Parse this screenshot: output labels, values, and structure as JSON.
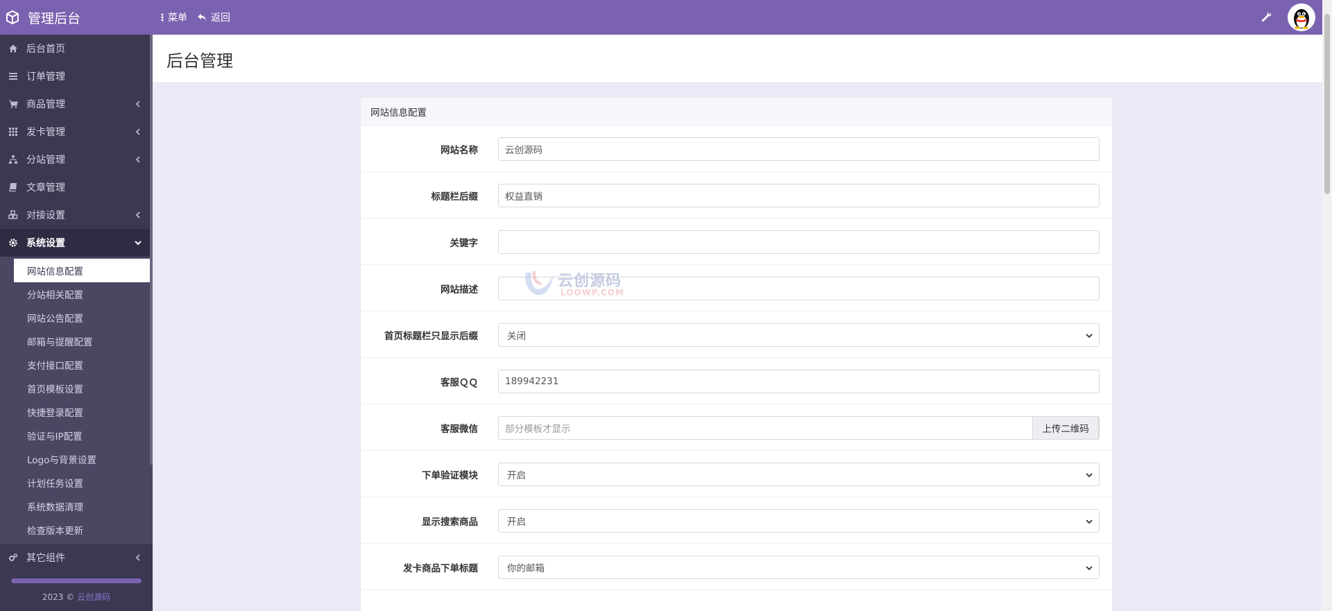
{
  "topbar": {
    "brand_title": "管理后台",
    "menu_label": "菜单",
    "back_label": "返回",
    "bg_color": "#7b62b0"
  },
  "sidebar": {
    "items_top": [
      {
        "label": "后台首页",
        "icon": "home-icon",
        "has_chevron": false
      },
      {
        "label": "订单管理",
        "icon": "list-icon",
        "has_chevron": false
      },
      {
        "label": "商品管理",
        "icon": "cart-icon",
        "has_chevron": true
      },
      {
        "label": "发卡管理",
        "icon": "grid-icon",
        "has_chevron": true
      },
      {
        "label": "分站管理",
        "icon": "sitemap-icon",
        "has_chevron": true
      },
      {
        "label": "文章管理",
        "icon": "book-icon",
        "has_chevron": false
      },
      {
        "label": "对接设置",
        "icon": "cubes-icon",
        "has_chevron": true
      }
    ],
    "active_group": {
      "label": "系统设置",
      "icon": "gear-icon"
    },
    "sub_items": [
      "网站信息配置",
      "分站相关配置",
      "网站公告配置",
      "邮箱与提醒配置",
      "支付接口配置",
      "首页模板设置",
      "快捷登录配置",
      "验证与IP配置",
      "Logo与背景设置",
      "计划任务设置",
      "系统数据清理",
      "检查版本更新"
    ],
    "active_sub_index": 0,
    "other": {
      "label": "其它组件",
      "icon": "cogs-icon"
    },
    "footer_year": "2023 ©",
    "footer_link": "云创源码"
  },
  "header": {
    "title": "后台管理"
  },
  "panel": {
    "heading": "网站信息配置",
    "fields": [
      {
        "label": "网站名称",
        "type": "text",
        "value": "云创源码"
      },
      {
        "label": "标题栏后缀",
        "type": "text",
        "value": "权益直销"
      },
      {
        "label": "关键字",
        "type": "text",
        "value": ""
      },
      {
        "label": "网站描述",
        "type": "text",
        "value": ""
      },
      {
        "label": "首页标题栏只显示后缀",
        "type": "select",
        "value": "关闭"
      },
      {
        "label": "客服ＱＱ",
        "type": "text",
        "value": "189942231"
      },
      {
        "label": "客服微信",
        "type": "text-addon",
        "value": "",
        "placeholder": "部分模板才显示",
        "button": "上传二维码"
      },
      {
        "label": "下单验证模块",
        "type": "select",
        "value": "开启"
      },
      {
        "label": "显示搜索商品",
        "type": "select",
        "value": "开启"
      },
      {
        "label": "发卡商品下单标题",
        "type": "select",
        "value": "你的邮箱"
      }
    ]
  },
  "watermark": {
    "cn": "云创源码",
    "en": "LOOWP.COM"
  }
}
